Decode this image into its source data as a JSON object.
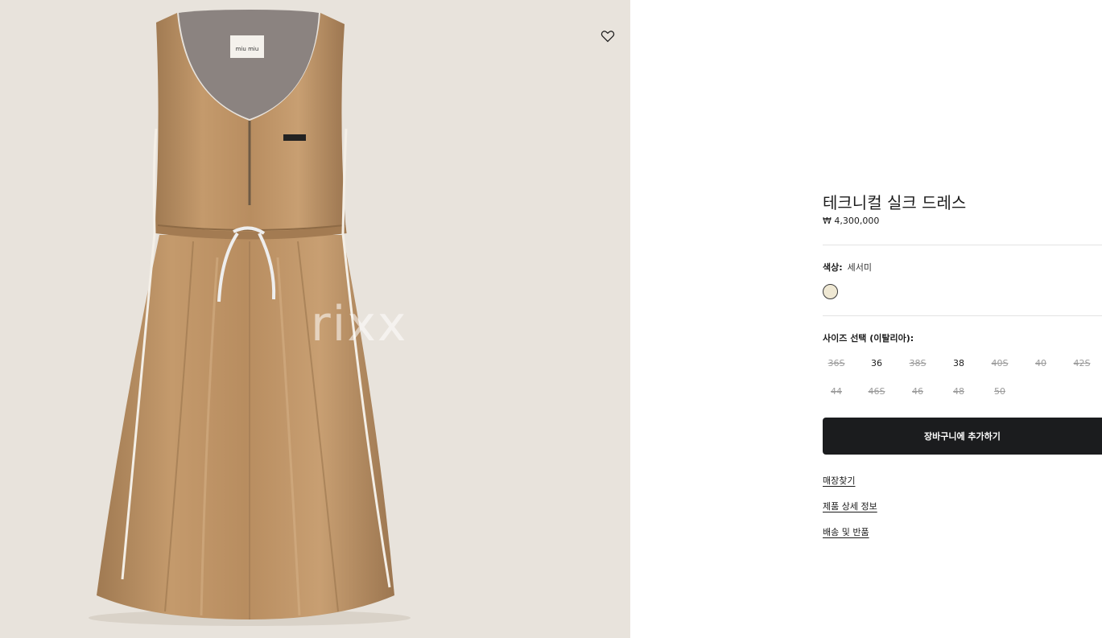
{
  "product": {
    "title": "테크니컬 실크 드레스",
    "price": "₩ 4,300,000",
    "brand_label": "miu miu",
    "watermark": "rixx"
  },
  "color": {
    "label": "색상:",
    "value": "세서미",
    "swatch_hex": "#efe8d3"
  },
  "size": {
    "label": "사이즈 선택 (이탈리아):",
    "options": [
      {
        "label": "36S",
        "available": false
      },
      {
        "label": "36",
        "available": true
      },
      {
        "label": "38S",
        "available": false
      },
      {
        "label": "38",
        "available": true
      },
      {
        "label": "40S",
        "available": false
      },
      {
        "label": "40",
        "available": false
      },
      {
        "label": "42S",
        "available": false
      },
      {
        "label": "44",
        "available": false
      },
      {
        "label": "46S",
        "available": false
      },
      {
        "label": "46",
        "available": false
      },
      {
        "label": "48",
        "available": false
      },
      {
        "label": "50",
        "available": false
      }
    ]
  },
  "actions": {
    "add_to_cart": "장바구니에 추가하기"
  },
  "links": {
    "store_finder": "매장찾기",
    "product_details": "제품 상세 정보",
    "shipping_returns": "배송 및 반품"
  },
  "icons": {
    "wishlist": "heart-icon"
  }
}
